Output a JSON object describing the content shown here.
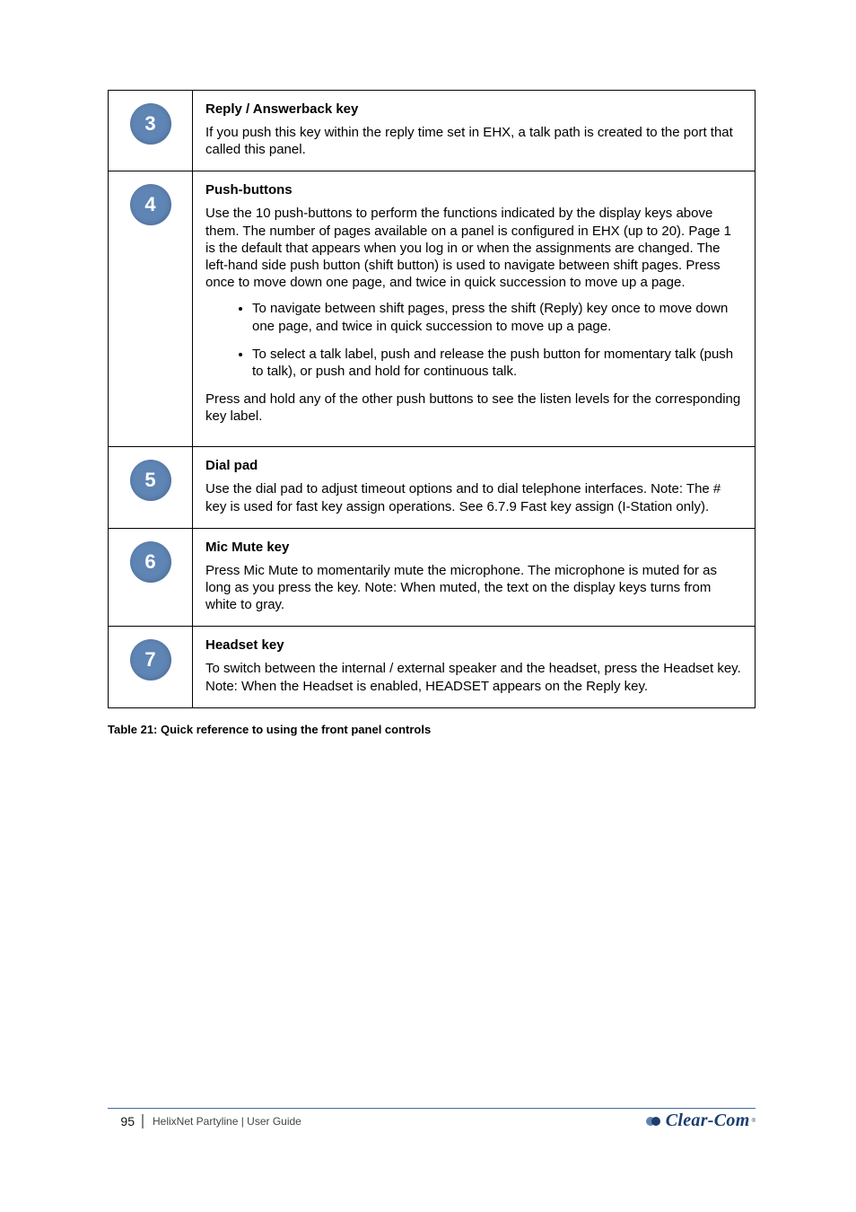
{
  "rows": [
    {
      "n": "3",
      "title": "Reply / Answerback key",
      "body": "If you push this key within the reply time set in EHX, a talk path is created to the port that called this panel."
    },
    {
      "n": "4",
      "title": "Push-buttons",
      "body": "Use the 10 push-buttons to perform the functions indicated by the display keys above them. The number of pages available on a panel is configured in EHX (up to 20). Page 1 is the default that appears when you log in or when the assignments are changed. The left-hand side push button (shift button) is used to navigate between shift pages. Press once to move down one page, and twice in quick succession to move up a page.",
      "bullets": [
        "To navigate between shift pages, press the shift (Reply) key once to move down one page, and twice in quick succession to move up a page.",
        "To select a talk label, push and release the push button for momentary talk (push to talk), or push and hold for continuous talk."
      ],
      "after_bullets_note": "Press and hold any of the other push buttons to see the listen levels for the corresponding key label."
    },
    {
      "n": "5",
      "title": "Dial pad",
      "body": "Use the dial pad to adjust timeout options and to dial telephone interfaces.\nNote: The # key is used for fast key assign operations. See 6.7.9 Fast key assign (I-Station only)."
    },
    {
      "n": "6",
      "title": "Mic Mute key",
      "body": "Press Mic Mute to momentarily mute the microphone. The microphone is muted for as long as you press the key.\nNote: When muted, the text on the display keys turns from white to gray."
    },
    {
      "n": "7",
      "title": "Headset key",
      "body": "To switch between the internal / external speaker and the headset, press the Headset key.\nNote: When the Headset is enabled, HEADSET appears on the Reply key."
    }
  ],
  "table_label": "Table 21: Quick reference to using the front panel controls",
  "footer": {
    "page": "95",
    "doc": "HelixNet Partyline | User Guide",
    "brand": "Clear-Com"
  }
}
